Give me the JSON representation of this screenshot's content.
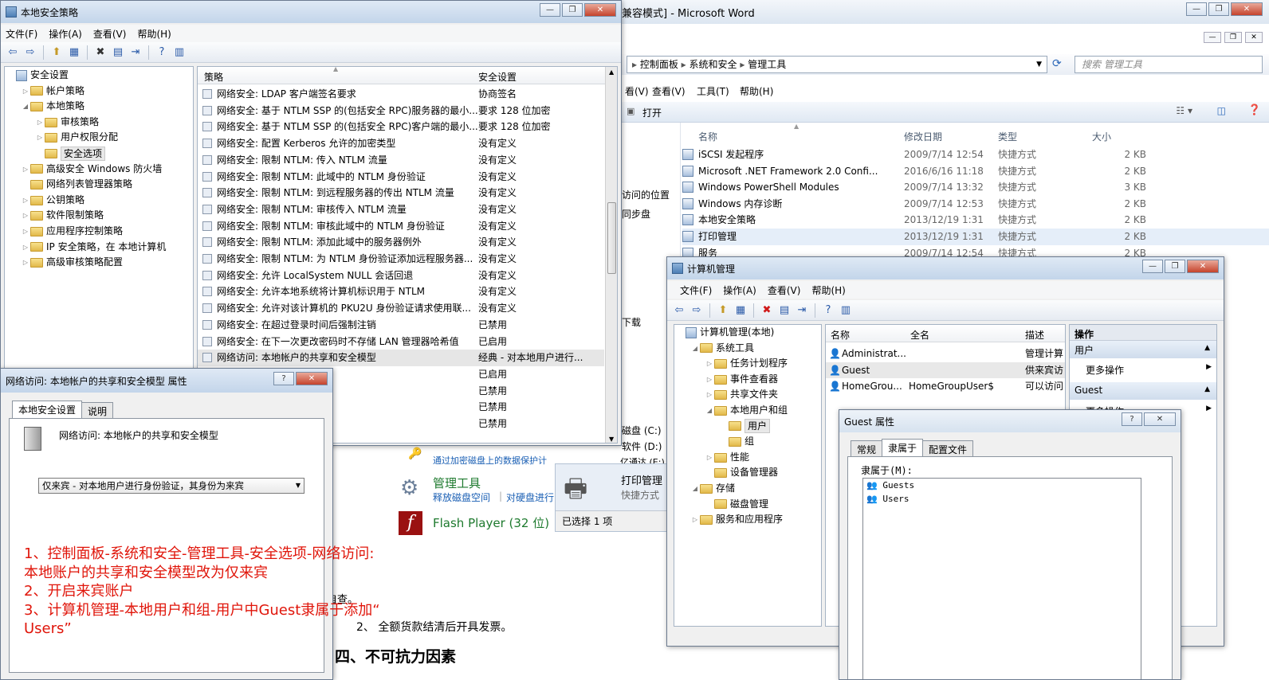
{
  "word": {
    "title": "兼容模式] - Microsoft Word",
    "doc_line": "2、 全额货款结清后开具发票。",
    "doc_heading": "四、不可抗力因素",
    "doc_fragment": "自查。"
  },
  "explorer": {
    "breadcrumb": [
      "控制面板",
      "系统和安全",
      "管理工具"
    ],
    "search_placeholder": "搜索 管理工具",
    "menu": [
      "看(V)",
      "查看(V)",
      "工具(T)",
      "帮助(H)"
    ],
    "open_btn": "打开",
    "columns": [
      "名称",
      "修改日期",
      "类型",
      "大小"
    ],
    "files": [
      {
        "name": "iSCSI 发起程序",
        "date": "2009/7/14 12:54",
        "type": "快捷方式",
        "size": "2 KB"
      },
      {
        "name": "Microsoft .NET Framework 2.0 Confi...",
        "date": "2016/6/16 11:18",
        "type": "快捷方式",
        "size": "2 KB"
      },
      {
        "name": "Windows PowerShell Modules",
        "date": "2009/7/14 13:32",
        "type": "快捷方式",
        "size": "3 KB"
      },
      {
        "name": "Windows 内存诊断",
        "date": "2009/7/14 12:53",
        "type": "快捷方式",
        "size": "2 KB"
      },
      {
        "name": "本地安全策略",
        "date": "2013/12/19 1:31",
        "type": "快捷方式",
        "size": "2 KB"
      },
      {
        "name": "打印管理",
        "date": "2013/12/19 1:31",
        "type": "快捷方式",
        "size": "2 KB"
      },
      {
        "name": "服务",
        "date": "2009/7/14 12:54",
        "type": "快捷方式",
        "size": "2 KB"
      }
    ],
    "left_frags": [
      "访问的位置",
      "同步盘",
      "下载"
    ],
    "drives": [
      "磁盘 (C:)",
      "软件 (D:)",
      "亿通达 (E:)"
    ],
    "print_name": "打印管理",
    "print_type": "快捷方式",
    "status": "已选择 1 项",
    "cp_link1": "通过加密磁盘上的数据保护计",
    "cp_title": "管理工具",
    "cp_link2": "释放磁盘空间",
    "cp_link3": "对硬盘进行",
    "cp_flash": "Flash Player (32 位)"
  },
  "lsp": {
    "title": "本地安全策略",
    "menu": [
      "文件(F)",
      "操作(A)",
      "查看(V)",
      "帮助(H)"
    ],
    "tree": [
      {
        "label": "安全设置",
        "indent": 0,
        "arrow": ""
      },
      {
        "label": "帐户策略",
        "indent": 1,
        "arrow": "▷"
      },
      {
        "label": "本地策略",
        "indent": 1,
        "arrow": "◢"
      },
      {
        "label": "审核策略",
        "indent": 2,
        "arrow": "▷"
      },
      {
        "label": "用户权限分配",
        "indent": 2,
        "arrow": "▷"
      },
      {
        "label": "安全选项",
        "indent": 2,
        "arrow": ""
      },
      {
        "label": "高级安全 Windows 防火墙",
        "indent": 1,
        "arrow": "▷"
      },
      {
        "label": "网络列表管理器策略",
        "indent": 1,
        "arrow": ""
      },
      {
        "label": "公钥策略",
        "indent": 1,
        "arrow": "▷"
      },
      {
        "label": "软件限制策略",
        "indent": 1,
        "arrow": "▷"
      },
      {
        "label": "应用程序控制策略",
        "indent": 1,
        "arrow": "▷"
      },
      {
        "label": "IP 安全策略，在 本地计算机",
        "indent": 1,
        "arrow": "▷"
      },
      {
        "label": "高级审核策略配置",
        "indent": 1,
        "arrow": "▷"
      }
    ],
    "col_policy": "策略",
    "col_setting": "安全设置",
    "rows": [
      {
        "p": "网络安全: LDAP 客户端签名要求",
        "s": "协商签名"
      },
      {
        "p": "网络安全: 基于 NTLM SSP 的(包括安全 RPC)服务器的最小...",
        "s": "要求 128 位加密"
      },
      {
        "p": "网络安全: 基于 NTLM SSP 的(包括安全 RPC)客户端的最小...",
        "s": "要求 128 位加密"
      },
      {
        "p": "网络安全: 配置 Kerberos 允许的加密类型",
        "s": "没有定义"
      },
      {
        "p": "网络安全: 限制 NTLM: 传入 NTLM 流量",
        "s": "没有定义"
      },
      {
        "p": "网络安全: 限制 NTLM: 此域中的 NTLM 身份验证",
        "s": "没有定义"
      },
      {
        "p": "网络安全: 限制 NTLM: 到远程服务器的传出 NTLM 流量",
        "s": "没有定义"
      },
      {
        "p": "网络安全: 限制 NTLM: 审核传入 NTLM 流量",
        "s": "没有定义"
      },
      {
        "p": "网络安全: 限制 NTLM: 审核此域中的 NTLM 身份验证",
        "s": "没有定义"
      },
      {
        "p": "网络安全: 限制 NTLM: 添加此域中的服务器例外",
        "s": "没有定义"
      },
      {
        "p": "网络安全: 限制 NTLM: 为 NTLM 身份验证添加远程服务器...",
        "s": "没有定义"
      },
      {
        "p": "网络安全: 允许 LocalSystem NULL 会话回退",
        "s": "没有定义"
      },
      {
        "p": "网络安全: 允许本地系统将计算机标识用于 NTLM",
        "s": "没有定义"
      },
      {
        "p": "网络安全: 允许对该计算机的 PKU2U 身份验证请求使用联...",
        "s": "没有定义"
      },
      {
        "p": "网络安全: 在超过登录时间后强制注销",
        "s": "已禁用"
      },
      {
        "p": "网络安全: 在下一次更改密码时不存储 LAN 管理器哈希值",
        "s": "已启用"
      },
      {
        "p": "网络访问: 本地帐户的共享和安全模型",
        "s": "经典 - 对本地用户进行..."
      },
      {
        "p": "的匿名枚举",
        "s": "已启用"
      },
      {
        "p": "和共享的匿名枚举",
        "s": "已禁用"
      },
      {
        "p": "份验证的密码和凭据",
        "s": "已禁用"
      },
      {
        "p": "应用于匿名用户",
        "s": "已禁用"
      }
    ]
  },
  "prop": {
    "title": "网络访问: 本地帐户的共享和安全模型 属性",
    "tabs": [
      "本地安全设置",
      "说明"
    ],
    "heading": "网络访问: 本地帐户的共享和安全模型",
    "select_value": "仅来宾 - 对本地用户进行身份验证，其身份为来宾"
  },
  "annotation": [
    "1、控制面板-系统和安全-管理工具-安全选项-网络访问:",
    "本地账户的共享和安全模型改为仅来宾",
    "2、开启来宾账户",
    "3、计算机管理-本地用户和组-用户中Guest隶属于添加“",
    "Users”"
  ],
  "cm": {
    "title": "计算机管理",
    "menu": [
      "文件(F)",
      "操作(A)",
      "查看(V)",
      "帮助(H)"
    ],
    "tree": [
      {
        "label": "计算机管理(本地)",
        "indent": 0,
        "arrow": ""
      },
      {
        "label": "系统工具",
        "indent": 1,
        "arrow": "◢"
      },
      {
        "label": "任务计划程序",
        "indent": 2,
        "arrow": "▷"
      },
      {
        "label": "事件查看器",
        "indent": 2,
        "arrow": "▷"
      },
      {
        "label": "共享文件夹",
        "indent": 2,
        "arrow": "▷"
      },
      {
        "label": "本地用户和组",
        "indent": 2,
        "arrow": "◢"
      },
      {
        "label": "用户",
        "indent": 3,
        "arrow": ""
      },
      {
        "label": "组",
        "indent": 3,
        "arrow": ""
      },
      {
        "label": "性能",
        "indent": 2,
        "arrow": "▷"
      },
      {
        "label": "设备管理器",
        "indent": 2,
        "arrow": ""
      },
      {
        "label": "存储",
        "indent": 1,
        "arrow": "◢"
      },
      {
        "label": "磁盘管理",
        "indent": 2,
        "arrow": ""
      },
      {
        "label": "服务和应用程序",
        "indent": 1,
        "arrow": "▷"
      }
    ],
    "cols": [
      "名称",
      "全名",
      "描述"
    ],
    "users": [
      {
        "name": "Administrat...",
        "full": "",
        "desc": "管理计算"
      },
      {
        "name": "Guest",
        "full": "",
        "desc": "供来宾访"
      },
      {
        "name": "HomeGrou...",
        "full": "HomeGroupUser$",
        "desc": "可以访问"
      }
    ],
    "actions_title": "操作",
    "act_users": "用户",
    "act_more": "更多操作",
    "act_guest": "Guest",
    "act_more2": "更多操作"
  },
  "guest": {
    "title": "Guest 属性",
    "tabs": [
      "常规",
      "隶属于",
      "配置文件"
    ],
    "member_label": "隶属于(M):",
    "members": [
      "Guests",
      "Users"
    ]
  }
}
